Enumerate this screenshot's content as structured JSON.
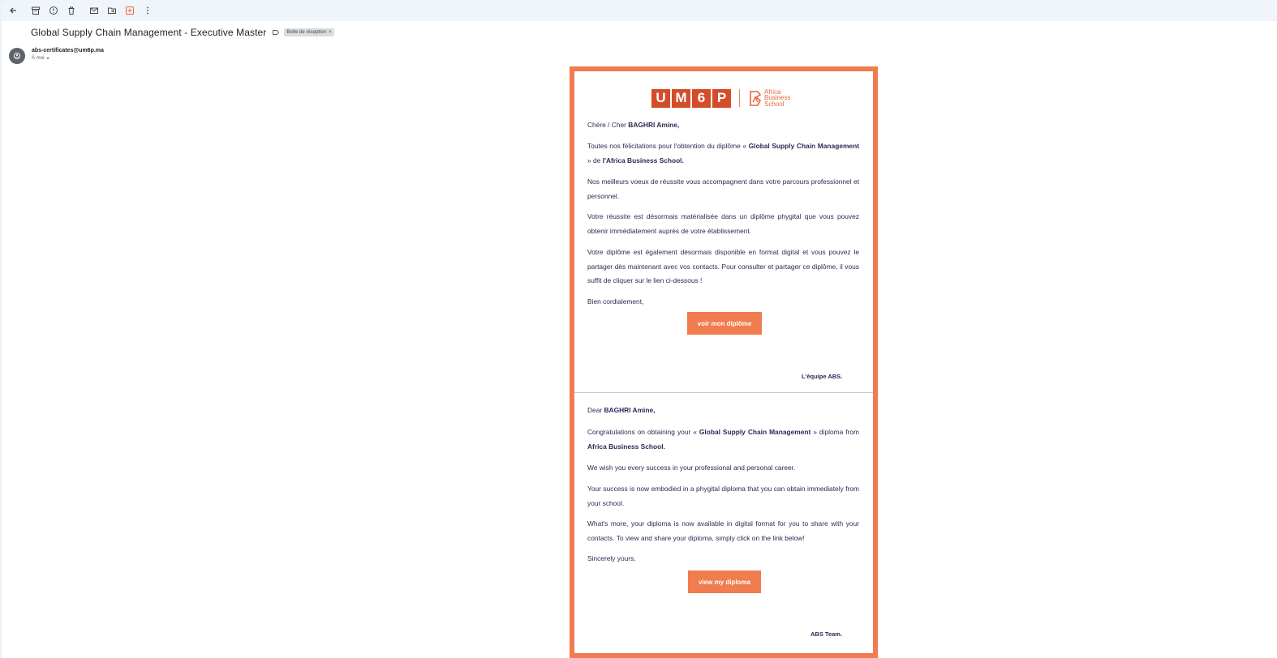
{
  "toolbar": {
    "icons": [
      "back-arrow-icon",
      "archive-icon",
      "report-icon",
      "delete-icon",
      "mark-unread-icon",
      "move-to-icon",
      "tasks-icon",
      "more-icon"
    ]
  },
  "email": {
    "subject": "Global Supply Chain Management - Executive Master",
    "label": "Boîte de réception",
    "label_close": "×",
    "sender": "abs-certificates@um6p.ma",
    "recipient": "À moi"
  },
  "logo": {
    "um6p_letters": [
      "U",
      "M",
      "6",
      "P"
    ],
    "abs_lines": [
      "Africa",
      "Business",
      "School"
    ]
  },
  "fr": {
    "greeting_prefix": "Chère / Cher ",
    "name": "BAGHRI Amine,",
    "p1_a": "Toutes nos félicitations pour l'obtention du diplôme « ",
    "p1_program": "Global Supply Chain Management",
    "p1_b": " » de ",
    "p1_school": "l'Africa Business School.",
    "p2": "Nos meilleurs voeux de réussite vous accompagnent dans votre parcours professionnel et personnel.",
    "p3": "Votre réussite est désormais matérialisée dans un diplôme phygital que vous pouvez obtenir immédiatement auprès de votre établissement.",
    "p4": "Votre diplôme est également désormais disponible en format digital et vous pouvez le partager dès maintenant avec vos contacts. Pour consulter et partager ce diplôme, il vous suffit de cliquer sur le lien ci-dessous !",
    "closing": "Bien cordialement,",
    "button": "voir mon diplôme",
    "signoff": "L'équipe ABS."
  },
  "en": {
    "greeting_prefix": "Dear ",
    "name": "BAGHRI Amine,",
    "p1_a": "Congratulations on obtaining your « ",
    "p1_program": "Global Supply Chain Management",
    "p1_b": " » diploma from ",
    "p1_school": "Africa Business School.",
    "p2": "We wish you every success in your professional and personal career.",
    "p3": "Your success is now embodied in a phygital diploma that you can obtain immediately from your school.",
    "p4": "What's more, your diploma is now available in digital format for you to share with your contacts. To view and share your diploma, simply click on the link below!",
    "closing": "Sincerely yours,",
    "button": "view my diploma",
    "signoff": "ABS Team."
  },
  "colors": {
    "accent": "#f07c4f",
    "brand_red": "#d44d2a",
    "body_text": "#2b2a55"
  }
}
